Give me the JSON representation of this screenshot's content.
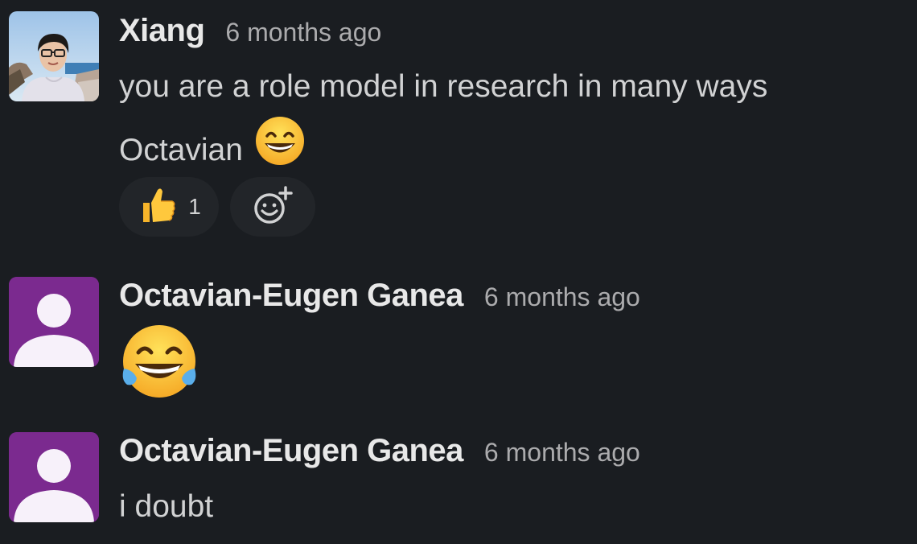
{
  "messages": [
    {
      "author": "Xiang",
      "timestamp": "6 months ago",
      "text_line1": "you are a role model in research in many ways",
      "text_line2": "Octavian",
      "inline_emoji": "grinning-face-with-smiling-eyes",
      "reactions": [
        {
          "emoji": "thumbs-up",
          "count": "1"
        },
        {
          "emoji": "add-reaction"
        }
      ],
      "avatar": "photo"
    },
    {
      "author": "Octavian-Eugen Ganea",
      "timestamp": "6 months ago",
      "emoji": "face-with-tears-of-joy",
      "avatar": "default-user"
    },
    {
      "author": "Octavian-Eugen Ganea",
      "timestamp": "6 months ago",
      "text": "i doubt",
      "avatar": "default-user"
    }
  ],
  "colors": {
    "background": "#1a1d21",
    "default_avatar": "#7b2a8f",
    "reaction_pill": "#222529",
    "author_text": "#e8e8e8",
    "timestamp_text": "#ababad",
    "body_text": "#d1d2d3"
  }
}
